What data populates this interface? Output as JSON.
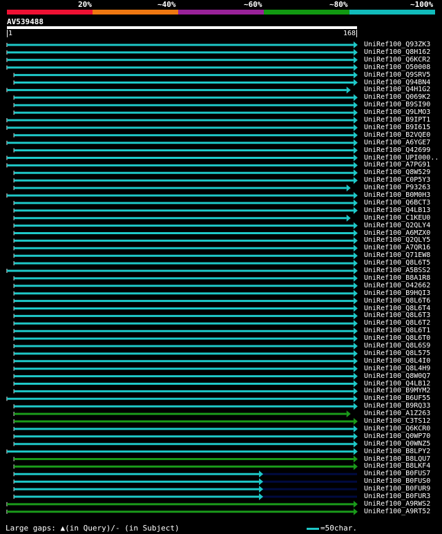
{
  "legend": {
    "labels": [
      "20%",
      "~40%",
      "~60%",
      "~80%",
      "~100%"
    ],
    "colors": [
      "#ee1133",
      "#ee7711",
      "#992299",
      "#119911",
      "#11bbbb"
    ]
  },
  "query": {
    "name": "AV539488",
    "start": "1",
    "end": "168"
  },
  "colors": {
    "cyan": "#1ec8c8",
    "green": "#1a9a1a",
    "navy": "#000a40"
  },
  "hits": [
    {
      "name": "UniRef100_Q93ZK3",
      "s": 0,
      "e": 0.99,
      "c": "cyan",
      "x": "none"
    },
    {
      "name": "UniRef100_Q8H162",
      "s": 0,
      "e": 0.99,
      "c": "cyan",
      "x": "none"
    },
    {
      "name": "UniRef100_Q6KCR2",
      "s": 0,
      "e": 0.99,
      "c": "cyan",
      "x": "none"
    },
    {
      "name": "UniRef100_O50008",
      "s": 0,
      "e": 0.99,
      "c": "cyan",
      "x": "none"
    },
    {
      "name": "UniRef100_Q9SRV5",
      "s": 0.02,
      "e": 0.99,
      "c": "cyan",
      "x": "none"
    },
    {
      "name": "UniRef100_Q94BN4",
      "s": 0.02,
      "e": 0.99,
      "c": "cyan",
      "x": "none"
    },
    {
      "name": "UniRef100_Q4H1G2",
      "s": 0,
      "e": 0.97,
      "c": "cyan",
      "x": "none"
    },
    {
      "name": "UniRef100_Q069K2",
      "s": 0.02,
      "e": 0.99,
      "c": "cyan",
      "x": "none"
    },
    {
      "name": "UniRef100_B9SI90",
      "s": 0.02,
      "e": 0.99,
      "c": "cyan",
      "x": "none"
    },
    {
      "name": "UniRef100_Q9LMO3",
      "s": 0.02,
      "e": 0.99,
      "c": "cyan",
      "x": "none"
    },
    {
      "name": "UniRef100_B9IPT1",
      "s": 0,
      "e": 0.99,
      "c": "cyan",
      "x": "none"
    },
    {
      "name": "UniRef100_B9I615",
      "s": 0,
      "e": 0.99,
      "c": "cyan",
      "x": "none"
    },
    {
      "name": "UniRef100_B2VQE0",
      "s": 0.02,
      "e": 0.99,
      "c": "cyan",
      "x": "none"
    },
    {
      "name": "UniRef100_A6YGE7",
      "s": 0,
      "e": 0.99,
      "c": "cyan",
      "x": "none"
    },
    {
      "name": "UniRef100_Q42699",
      "s": 0.02,
      "e": 0.99,
      "c": "cyan",
      "x": "none"
    },
    {
      "name": "UniRef100_UPI000..",
      "s": 0,
      "e": 0.99,
      "c": "cyan",
      "x": "none"
    },
    {
      "name": "UniRef100_A7PG91",
      "s": 0,
      "e": 0.99,
      "c": "cyan",
      "x": "none"
    },
    {
      "name": "UniRef100_Q8W529",
      "s": 0.02,
      "e": 0.99,
      "c": "cyan",
      "x": "none"
    },
    {
      "name": "UniRef100_C0P5Y3",
      "s": 0.02,
      "e": 0.99,
      "c": "cyan",
      "x": "none"
    },
    {
      "name": "UniRef100_P93263",
      "s": 0.02,
      "e": 0.97,
      "c": "cyan",
      "x": "none"
    },
    {
      "name": "UniRef100_B0M0H3",
      "s": 0,
      "e": 0.99,
      "c": "cyan",
      "x": "none"
    },
    {
      "name": "UniRef100_Q6BCT3",
      "s": 0.02,
      "e": 0.99,
      "c": "cyan",
      "x": "none"
    },
    {
      "name": "UniRef100_Q4LB13",
      "s": 0.02,
      "e": 0.99,
      "c": "cyan",
      "x": "none"
    },
    {
      "name": "UniRef100_C1KEU0",
      "s": 0.02,
      "e": 0.97,
      "c": "cyan",
      "x": "none"
    },
    {
      "name": "UniRef100_Q2QLY4",
      "s": 0.02,
      "e": 0.99,
      "c": "cyan",
      "x": "none"
    },
    {
      "name": "UniRef100_A6MZX0",
      "s": 0.02,
      "e": 0.99,
      "c": "cyan",
      "x": "none"
    },
    {
      "name": "UniRef100_Q2QLY5",
      "s": 0.02,
      "e": 0.99,
      "c": "cyan",
      "x": "none"
    },
    {
      "name": "UniRef100_A7QR16",
      "s": 0.02,
      "e": 0.99,
      "c": "cyan",
      "x": "none"
    },
    {
      "name": "UniRef100_Q71EW8",
      "s": 0.02,
      "e": 0.99,
      "c": "cyan",
      "x": "none"
    },
    {
      "name": "UniRef100_Q8L6T5",
      "s": 0.02,
      "e": 0.99,
      "c": "cyan",
      "x": "none"
    },
    {
      "name": "UniRef100_A5BSS2",
      "s": 0,
      "e": 0.99,
      "c": "cyan",
      "x": "none"
    },
    {
      "name": "UniRef100_B8A1R8",
      "s": 0.02,
      "e": 0.99,
      "c": "cyan",
      "x": "none"
    },
    {
      "name": "UniRef100_O42662",
      "s": 0.02,
      "e": 0.99,
      "c": "cyan",
      "x": "none"
    },
    {
      "name": "UniRef100_B9HQI3",
      "s": 0.02,
      "e": 0.99,
      "c": "cyan",
      "x": "none"
    },
    {
      "name": "UniRef100_Q8L6T6",
      "s": 0.02,
      "e": 0.99,
      "c": "cyan",
      "x": "none"
    },
    {
      "name": "UniRef100_Q8L6T4",
      "s": 0.02,
      "e": 0.99,
      "c": "cyan",
      "x": "none"
    },
    {
      "name": "UniRef100_Q8L6T3",
      "s": 0.02,
      "e": 0.99,
      "c": "cyan",
      "x": "none"
    },
    {
      "name": "UniRef100_Q8L6T2",
      "s": 0.02,
      "e": 0.99,
      "c": "cyan",
      "x": "none"
    },
    {
      "name": "UniRef100_Q8L6T1",
      "s": 0.02,
      "e": 0.99,
      "c": "cyan",
      "x": "none"
    },
    {
      "name": "UniRef100_Q8L6T0",
      "s": 0.02,
      "e": 0.99,
      "c": "cyan",
      "x": "none"
    },
    {
      "name": "UniRef100_Q8L6S9",
      "s": 0.02,
      "e": 0.99,
      "c": "cyan",
      "x": "none"
    },
    {
      "name": "UniRef100_Q8L575",
      "s": 0.02,
      "e": 0.99,
      "c": "cyan",
      "x": "none"
    },
    {
      "name": "UniRef100_Q8L4I0",
      "s": 0.02,
      "e": 0.99,
      "c": "cyan",
      "x": "none"
    },
    {
      "name": "UniRef100_Q8L4H9",
      "s": 0.02,
      "e": 0.99,
      "c": "cyan",
      "x": "none"
    },
    {
      "name": "UniRef100_Q8W0Q7",
      "s": 0.02,
      "e": 0.99,
      "c": "cyan",
      "x": "none"
    },
    {
      "name": "UniRef100_Q4LB12",
      "s": 0.02,
      "e": 0.99,
      "c": "cyan",
      "x": "none"
    },
    {
      "name": "UniRef100_B9MYM2",
      "s": 0.02,
      "e": 0.99,
      "c": "cyan",
      "x": "none"
    },
    {
      "name": "UniRef100_B6UF55",
      "s": 0,
      "e": 0.99,
      "c": "cyan",
      "x": "none"
    },
    {
      "name": "UniRef100_B9RQ33",
      "s": 0.02,
      "e": 0.99,
      "c": "cyan",
      "x": "none"
    },
    {
      "name": "UniRef100_A1Z263",
      "s": 0.02,
      "e": 0.97,
      "c": "green",
      "x": "none"
    },
    {
      "name": "UniRef100_C3TS12",
      "s": 0.02,
      "e": 0.99,
      "c": "green",
      "x": "none"
    },
    {
      "name": "UniRef100_Q6KCR0",
      "s": 0.02,
      "e": 0.99,
      "c": "cyan",
      "x": "none"
    },
    {
      "name": "UniRef100_Q0WP70",
      "s": 0.02,
      "e": 0.99,
      "c": "cyan",
      "x": "none"
    },
    {
      "name": "UniRef100_Q0WNZ5",
      "s": 0.02,
      "e": 0.99,
      "c": "cyan",
      "x": "none"
    },
    {
      "name": "UniRef100_B8LPY2",
      "s": 0,
      "e": 0.99,
      "c": "cyan",
      "x": "none"
    },
    {
      "name": "UniRef100_B8LQU7",
      "s": 0.02,
      "e": 0.99,
      "c": "green",
      "x": "none"
    },
    {
      "name": "UniRef100_B8LKF4",
      "s": 0.02,
      "e": 0.99,
      "c": "green",
      "x": "none"
    },
    {
      "name": "UniRef100_B0FUS7",
      "s": 0.02,
      "e": 0.72,
      "c": "cyan",
      "x": "navy"
    },
    {
      "name": "UniRef100_B0FUS0",
      "s": 0.02,
      "e": 0.72,
      "c": "cyan",
      "x": "navy"
    },
    {
      "name": "UniRef100_B0FUR9",
      "s": 0.02,
      "e": 0.72,
      "c": "cyan",
      "x": "navy"
    },
    {
      "name": "UniRef100_B0FUR3",
      "s": 0.02,
      "e": 0.72,
      "c": "cyan",
      "x": "navy"
    },
    {
      "name": "UniRef100_A9RWS2",
      "s": 0,
      "e": 0.99,
      "c": "green",
      "x": "none"
    },
    {
      "name": "UniRef100_A9RT52",
      "s": 0,
      "e": 0.99,
      "c": "green",
      "x": "none"
    }
  ],
  "footer": {
    "gaps_text": "Large gaps: ▲(in Query)/- (in Subject)",
    "scale_text": "=50char."
  }
}
